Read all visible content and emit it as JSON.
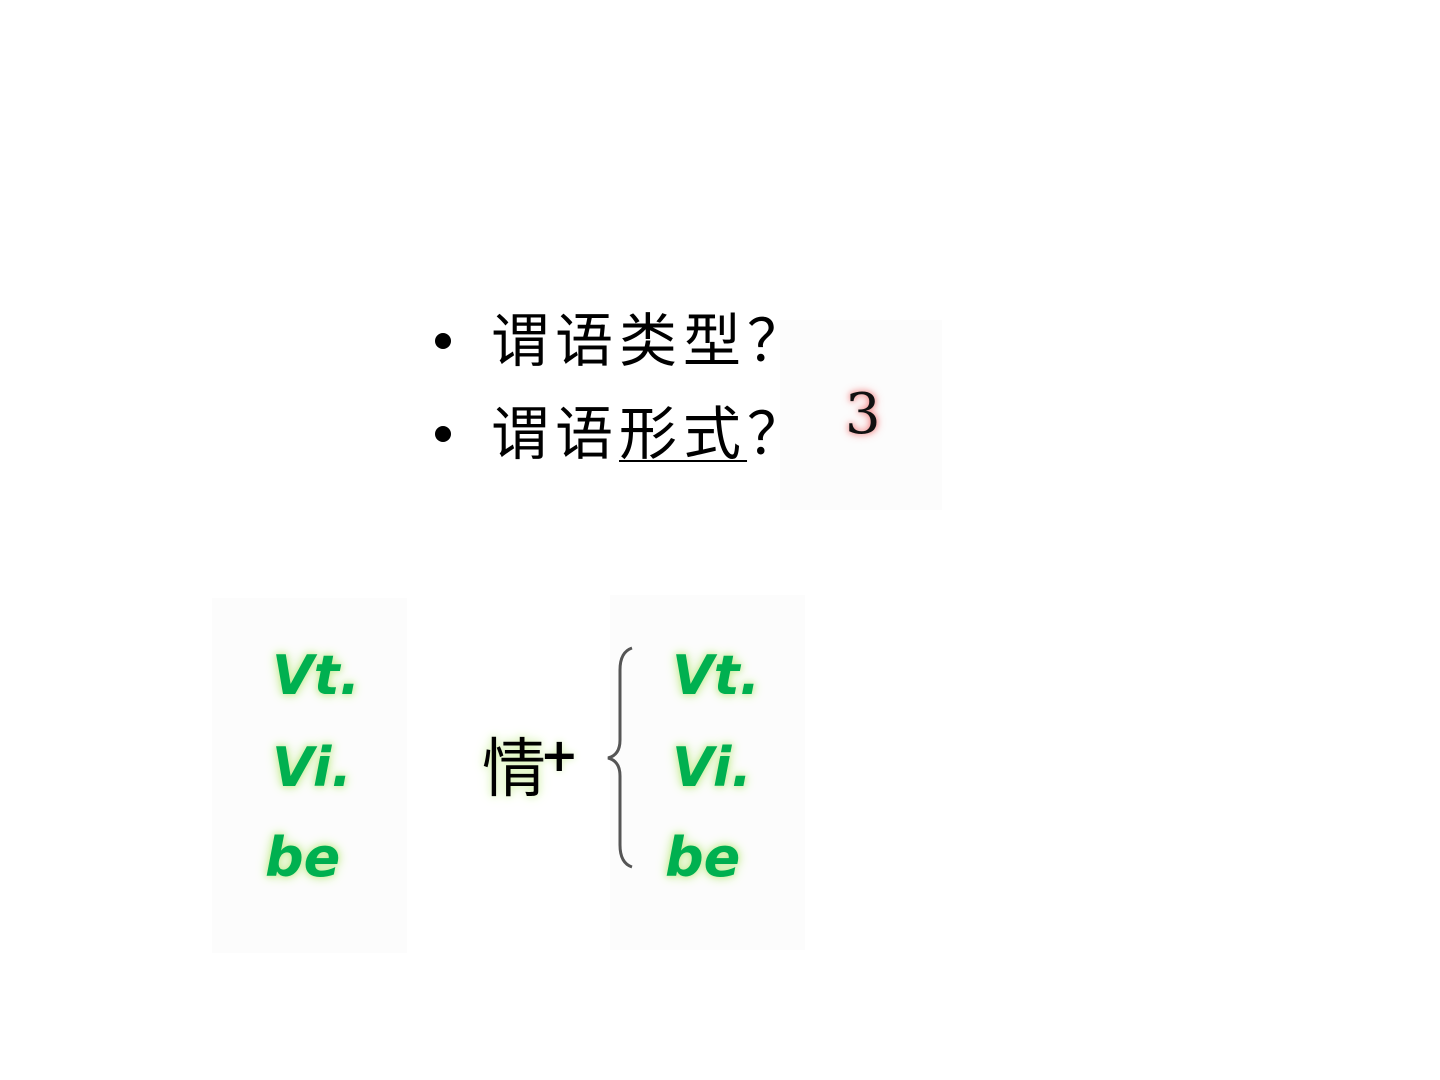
{
  "bullets": [
    {
      "prefix": "谓语",
      "rest": "类型",
      "suffix": "？"
    },
    {
      "prefix": "谓语",
      "rest": "形式",
      "suffix": "？",
      "underlined": true
    }
  ],
  "badge_number": "3",
  "left_column": [
    "Vt.",
    "Vi.",
    "be"
  ],
  "modal_label": "情",
  "plus_sign": "+",
  "right_column": [
    "Vt.",
    "Vi.",
    "be"
  ],
  "colors": {
    "green_text": "#00b050",
    "glow": "#d6f2b0",
    "badge_glow": "#f08080"
  }
}
